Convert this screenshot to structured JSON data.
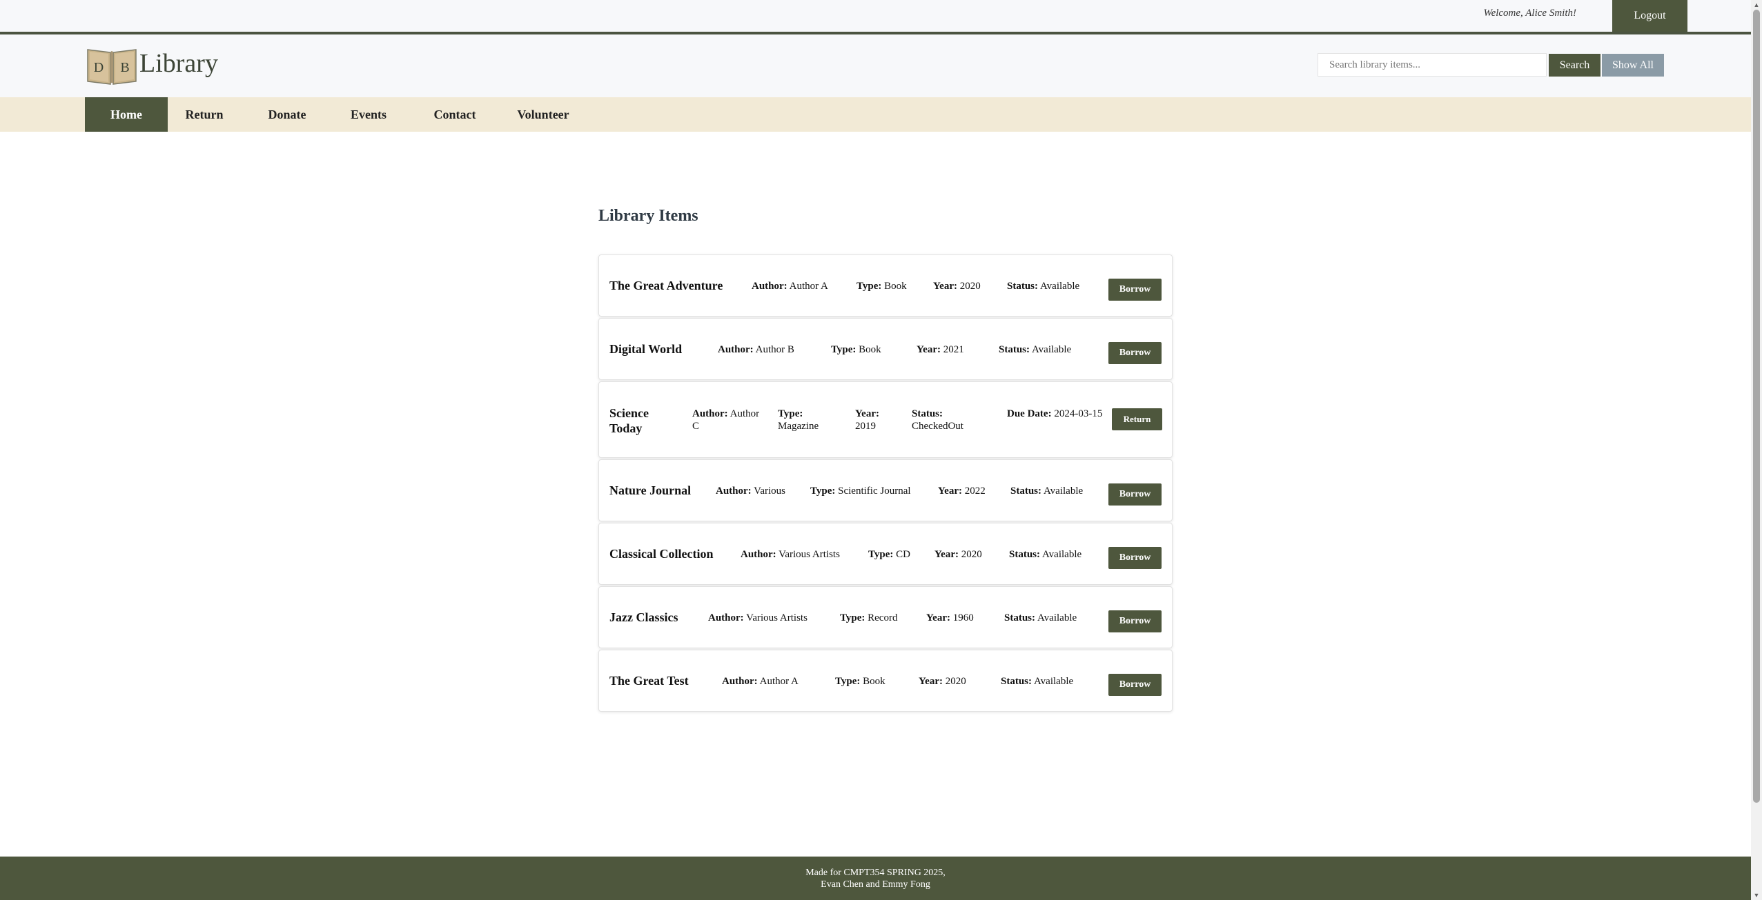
{
  "topbar": {
    "welcome": "Welcome, Alice Smith!",
    "logout_label": "Logout"
  },
  "header": {
    "logo_icon_letters": "DB",
    "logo_text": "Library",
    "search_placeholder": "Search library items...",
    "search_label": "Search",
    "show_all_label": "Show All"
  },
  "nav": {
    "items": [
      {
        "label": "Home",
        "active": true
      },
      {
        "label": "Return"
      },
      {
        "label": "Donate"
      },
      {
        "label": "Events"
      },
      {
        "label": "Contact"
      },
      {
        "label": "Volunteer"
      }
    ]
  },
  "main": {
    "title": "Library Items",
    "field_labels": {
      "author": "Author:",
      "type": "Type:",
      "year": "Year:",
      "status": "Status:",
      "due": "Due Date:"
    },
    "items": [
      {
        "title": "The Great Adventure",
        "author": "Author A",
        "type": "Book",
        "year": "2020",
        "status": "Available",
        "button": "Borrow"
      },
      {
        "title": "Digital World",
        "author": "Author B",
        "type": "Book",
        "year": "2021",
        "status": "Available",
        "button": "Borrow"
      },
      {
        "title": "Science Today",
        "author": "Author C",
        "type": "Magazine",
        "year": "2019",
        "status": "CheckedOut",
        "due_date": "2024-03-15",
        "button": "Return"
      },
      {
        "title": "Nature Journal",
        "author": "Various",
        "type": "Scientific Journal",
        "year": "2022",
        "status": "Available",
        "button": "Borrow"
      },
      {
        "title": "Classical Collection",
        "author": "Various Artists",
        "type": "CD",
        "year": "2020",
        "status": "Available",
        "button": "Borrow"
      },
      {
        "title": "Jazz Classics",
        "author": "Various Artists",
        "type": "Record",
        "year": "1960",
        "status": "Available",
        "button": "Borrow"
      },
      {
        "title": "The Great Test",
        "author": "Author A",
        "type": "Book",
        "year": "2020",
        "status": "Available",
        "button": "Borrow"
      }
    ]
  },
  "footer": {
    "line1": "Made for CMPT354 SPRING 2025,",
    "line2": "Evan Chen and Emmy Fong"
  },
  "colors": {
    "primary": "#4e573d",
    "nav_bg": "#f2ead6",
    "show_all": "#8b9ba6",
    "header_bg": "#f7f8fa"
  },
  "icons": {
    "logo": "book-logo-icon"
  }
}
